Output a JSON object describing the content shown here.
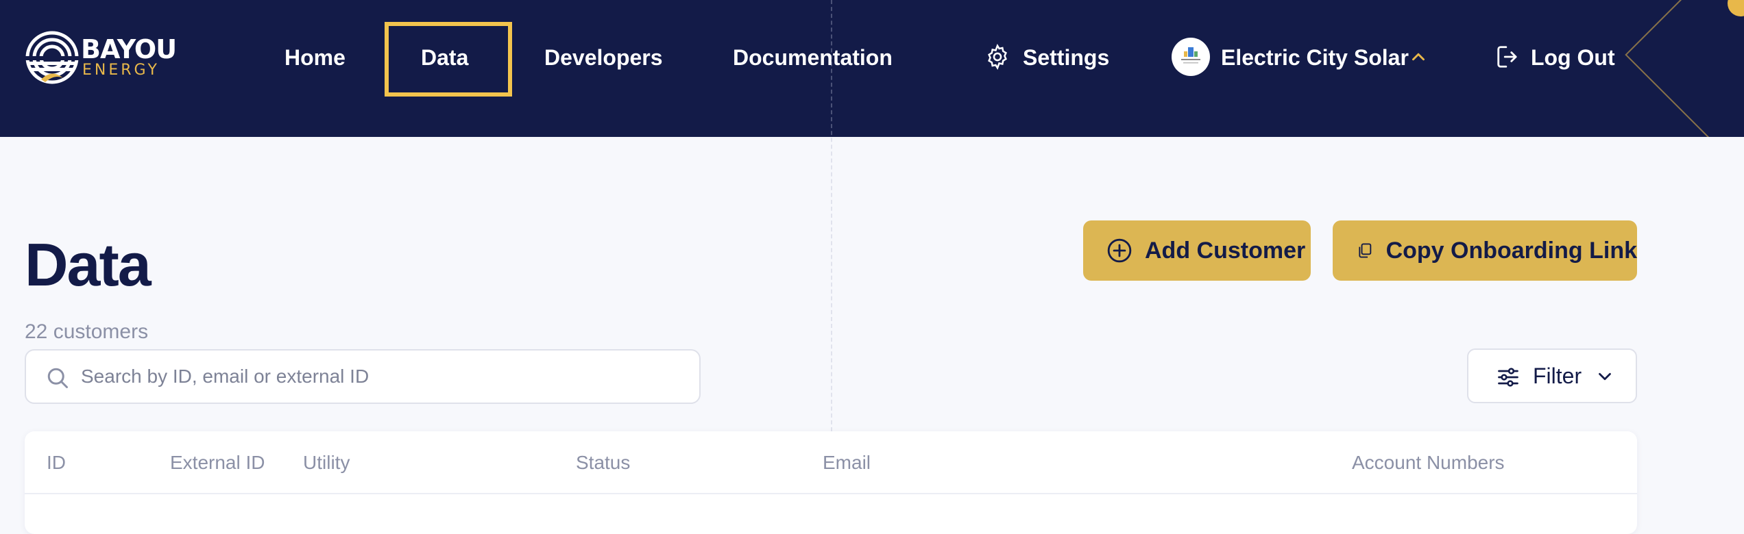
{
  "brand": {
    "name_line1": "BAYOU",
    "name_line2": "ENERGY"
  },
  "nav": {
    "home": "Home",
    "data": "Data",
    "developers": "Developers",
    "documentation": "Documentation",
    "settings": "Settings",
    "org_name": "Electric City Solar",
    "logout": "Log Out"
  },
  "page": {
    "title": "Data",
    "customer_count": "22 customers",
    "add_customer": "Add Customer",
    "copy_link": "Copy Onboarding Link",
    "search_placeholder": "Search by ID, email or external ID",
    "filter": "Filter"
  },
  "table": {
    "columns": [
      "ID",
      "External ID",
      "Utility",
      "Status",
      "Email",
      "Account Numbers"
    ]
  },
  "colors": {
    "navy": "#131b48",
    "gold": "#dcb653",
    "active_outline": "#f3c44d"
  }
}
